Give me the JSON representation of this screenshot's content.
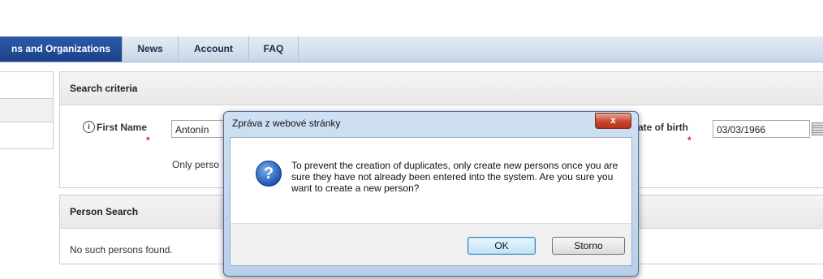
{
  "nav": {
    "tabs": [
      {
        "label": "ns and Organizations"
      },
      {
        "label": "News"
      },
      {
        "label": "Account"
      },
      {
        "label": "FAQ"
      }
    ]
  },
  "search_panel": {
    "title": "Search criteria",
    "first_name_label": "First Name",
    "first_name_value": "Antonín",
    "date_of_birth_label": "ate of birth",
    "date_of_birth_value": "03/03/1966",
    "required_mark": "*",
    "note": "Only perso"
  },
  "person_panel": {
    "title": "Person Search",
    "empty_message": "No such persons found."
  },
  "dialog": {
    "title": "Zpráva z webové stránky",
    "close_label": "x",
    "message": "To prevent the creation of duplicates, only create new persons once you are sure they have not already been entered into the system. Are you sure you want to create a new person?",
    "ok_label": "OK",
    "cancel_label": "Storno"
  }
}
